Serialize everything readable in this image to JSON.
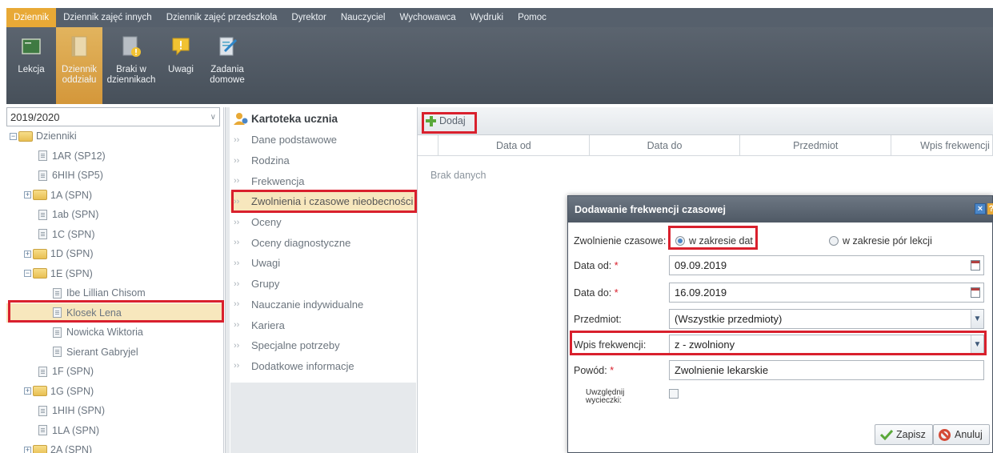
{
  "menu": {
    "items": [
      "Dziennik",
      "Dziennik zajęć innych",
      "Dziennik zajęć przedszkola",
      "Dyrektor",
      "Nauczyciel",
      "Wychowawca",
      "Wydruki",
      "Pomoc"
    ]
  },
  "ribbon": {
    "buttons": [
      {
        "label": "Lekcja",
        "icon": "lesson-icon"
      },
      {
        "label": "Dziennik\noddziału",
        "icon": "class-journal-icon"
      },
      {
        "label": "Braki w\ndziennikach",
        "icon": "journal-gaps-icon"
      },
      {
        "label": "Uwagi",
        "icon": "remarks-icon"
      },
      {
        "label": "Zadania\ndomowe",
        "icon": "homework-icon"
      }
    ]
  },
  "tree": {
    "year": "2019/2020",
    "root": "Dzienniki",
    "nodes": [
      "1AR (SP12)",
      "6HIH (SP5)",
      "1A (SPN)",
      "1ab (SPN)",
      "1C (SPN)",
      "1D (SPN)",
      "1E (SPN)",
      "Ibe Lillian Chisom",
      "Klosek Lena",
      "Nowicka Wiktoria",
      "Sierant Gabryjel",
      "1F (SPN)",
      "1G (SPN)",
      "1HIH (SPN)",
      "1LA (SPN)",
      "2A (SPN)"
    ]
  },
  "kartoteka": {
    "title": "Kartoteka ucznia",
    "items": [
      "Dane podstawowe",
      "Rodzina",
      "Frekwencja",
      "Zwolnienia i czasowe nieobecności",
      "Oceny",
      "Oceny diagnostyczne",
      "Uwagi",
      "Grupy",
      "Nauczanie indywidualne",
      "Kariera",
      "Specjalne potrzeby",
      "Dodatkowe informacje"
    ]
  },
  "grid": {
    "add_label": "Dodaj",
    "columns": [
      "Data od",
      "Data do",
      "Przedmiot",
      "Wpis frekwencji"
    ],
    "empty": "Brak danych"
  },
  "dialog": {
    "title": "Dodawanie frekwencji czasowej",
    "close": "×",
    "help": "?",
    "zwolnienie_label": "Zwolnienie czasowe:",
    "radio_dates": "w zakresie dat",
    "radio_lessons": "w zakresie pór lekcji",
    "data_od_label": "Data od:",
    "data_od": "09.09.2019",
    "data_do_label": "Data do:",
    "data_do": "16.09.2019",
    "przedmiot_label": "Przedmiot:",
    "przedmiot": "(Wszystkie przedmioty)",
    "wpis_label": "Wpis frekwencji:",
    "wpis": "z - zwolniony",
    "powod_label": "Powód:",
    "powod": "Zwolnienie lekarskie",
    "wycieczki_label": "Uwzględnij\nwycieczki:",
    "save": "Zapisz",
    "cancel": "Anuluj",
    "required": "*"
  },
  "colors": {
    "accent": "#e8a936",
    "menubar": "#56606c",
    "highlight": "#d9202d",
    "selection": "#f7e7bd"
  }
}
